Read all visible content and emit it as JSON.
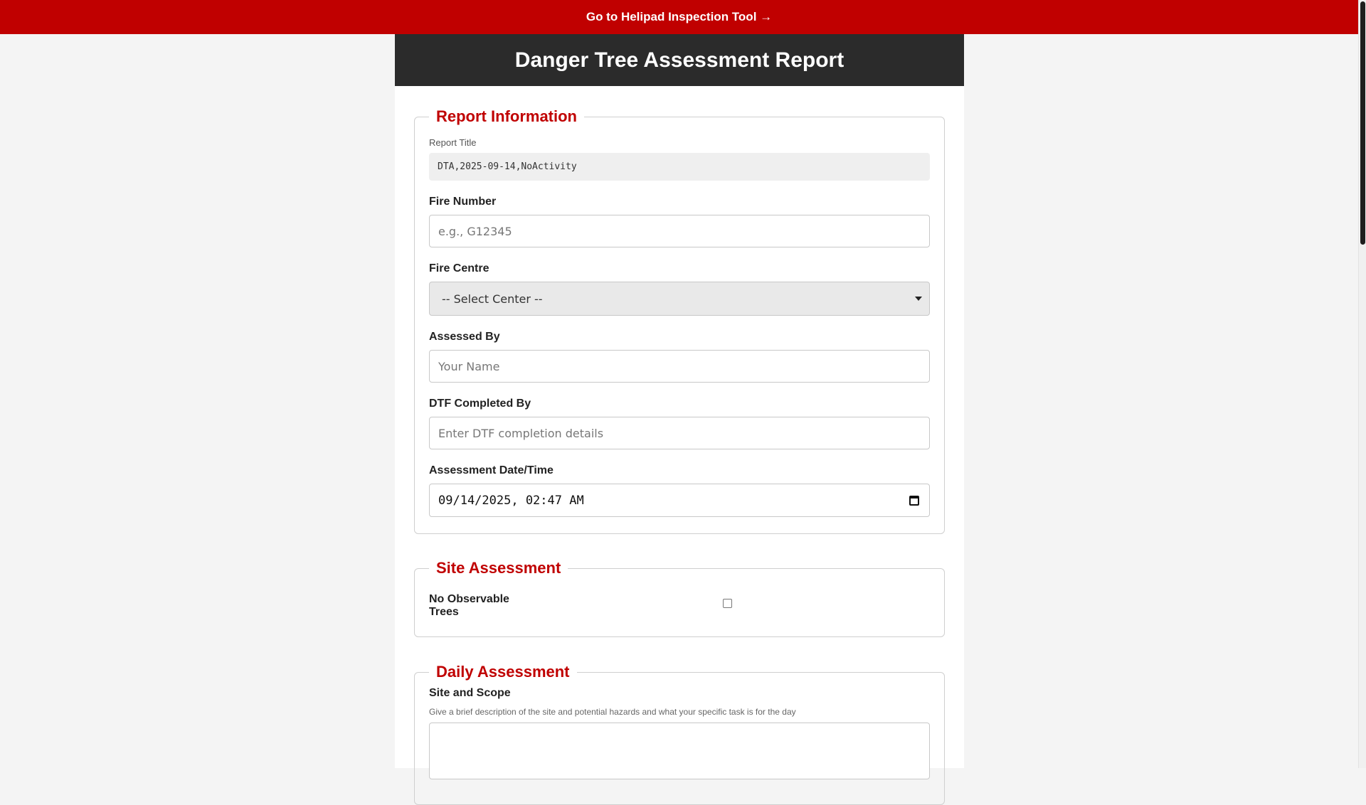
{
  "topbar": {
    "link_label": "Go to Helipad Inspection Tool →"
  },
  "header": {
    "title": "Danger Tree Assessment Report"
  },
  "report_info": {
    "legend": "Report Information",
    "report_title_label": "Report Title",
    "report_title_value": "DTA,2025-09-14,NoActivity",
    "fire_number_label": "Fire Number",
    "fire_number_placeholder": "e.g., G12345",
    "fire_centre_label": "Fire Centre",
    "fire_centre_selected": "-- Select Center --",
    "assessed_by_label": "Assessed By",
    "assessed_by_placeholder": "Your Name",
    "dtf_label": "DTF Completed By",
    "dtf_placeholder": "Enter DTF completion details",
    "datetime_label": "Assessment Date/Time",
    "datetime_value": "09/14/2025, 02:47 AM"
  },
  "site_assessment": {
    "legend": "Site Assessment",
    "no_trees_label": "No Observable Trees",
    "no_trees_checked": false
  },
  "daily_assessment": {
    "legend": "Daily Assessment",
    "site_scope_label": "Site and Scope",
    "site_scope_help": "Give a brief description of the site and potential hazards and what your specific task is for the day"
  },
  "colors": {
    "accent": "#c00000",
    "header_bg": "#2b2b2b"
  }
}
